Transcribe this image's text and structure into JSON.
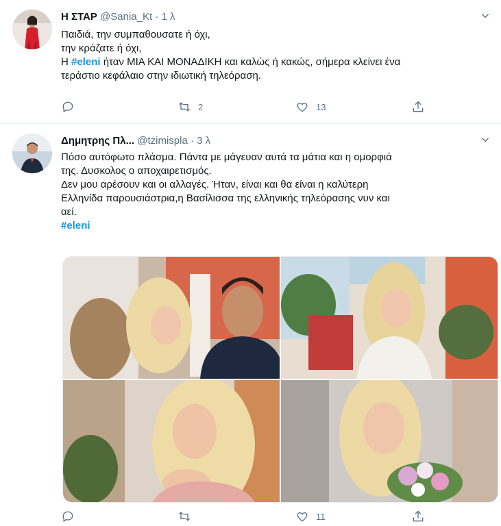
{
  "tweets": [
    {
      "display_name": "Η ΣΤΑΡ",
      "handle": "@Sania_Kt",
      "separator": "·",
      "time": "1 λ",
      "text_lines": [
        "Παιδιά, την συμπαθουσατε ή όχι,",
        "την κράζατε ή όχι,"
      ],
      "line3_prefix": "Η ",
      "hashtag": "#eleni",
      "line3_suffix": " ήταν ΜΙΑ ΚΑΙ ΜΟΝΑΔΙΚΗ και καλώς ή κακώς, σήμερα κλείνει ένα",
      "line4": "τεράστιο κεφάλαιο στην ιδιωτική τηλεόραση.",
      "retweets": "2",
      "likes": "13"
    },
    {
      "display_name": "Δημητρης Πλ...",
      "handle": "@tzimispla",
      "separator": "·",
      "time": "3 λ",
      "text_lines": [
        "Πόσο αυτόφωτο πλάσμα. Πάντα με μάγευαν αυτά τα μάτια και η ομορφιά",
        "της. Δυσκολος ο αποχαιρετισμός.",
        "Δεν μου αρέσουν και οι αλλαγές. Ήταν, είναι και θα είναι η καλύτερη",
        "Ελληνίδα παρουσιάστρια,η Βασίλισσα της ελληνικής τηλεόρασης νυν και",
        "αεί."
      ],
      "hashtag": "#eleni",
      "retweets": "",
      "likes": "11"
    }
  ],
  "icons": {
    "reply": "reply-icon",
    "retweet": "retweet-icon",
    "like": "heart-icon",
    "share": "share-icon",
    "caret": "chevron-down-icon"
  },
  "colors": {
    "hashtag": "#1b95e0",
    "meta": "#5b7083",
    "divider": "#e6ecf0"
  }
}
